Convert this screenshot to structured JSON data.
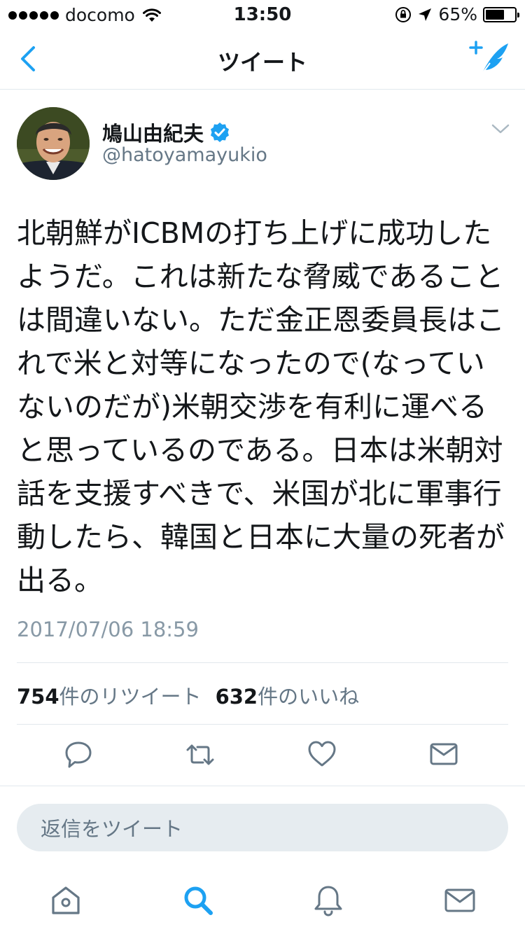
{
  "status_bar": {
    "carrier": "docomo",
    "time": "13:50",
    "battery_percent": "65%",
    "battery_level": 0.65,
    "signal_bars_filled": 5
  },
  "nav": {
    "title": "ツイート",
    "back_icon": "chevron-left-icon",
    "compose_icon": "compose-tweet-icon",
    "accent_color": "#1da1f2"
  },
  "tweet": {
    "author_name": "鳩山由紀夫",
    "verified": true,
    "handle": "@hatoyamayukio",
    "text": "北朝鮮がICBMの打ち上げに成功したようだ。これは新たな脅威であることは間違いない。ただ金正恩委員長はこれで米と対等になったので(なっていないのだが)米朝交渉を有利に運べると思っているのである。日本は米朝対話を支援すべきで、米国が北に軍事行動したら、韓国と日本に大量の死者が出る。",
    "timestamp": "2017/07/06 18:59",
    "retweet_count": "754",
    "retweet_label": "件のリツイート",
    "like_count": "632",
    "like_label": "件のいいね"
  },
  "actions": {
    "icons": [
      "reply-icon",
      "retweet-icon",
      "like-icon",
      "direct-message-icon"
    ]
  },
  "reply": {
    "placeholder": "返信をツイート"
  },
  "tab_bar": {
    "icons": [
      "home-icon",
      "search-icon",
      "notifications-icon",
      "messages-icon"
    ],
    "active": "search-icon"
  }
}
